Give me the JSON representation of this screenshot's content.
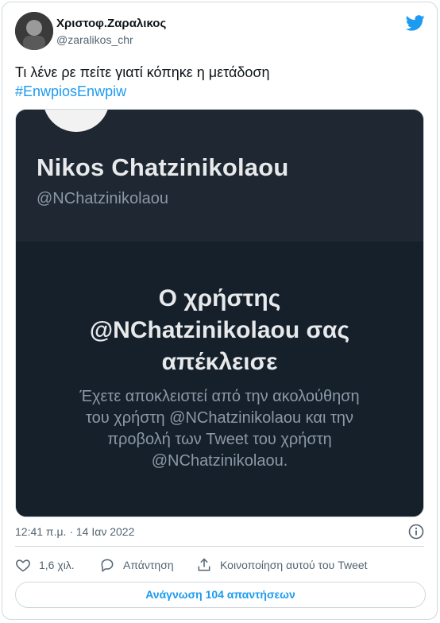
{
  "author": {
    "display_name": "Χριστοφ.Ζαραλικος",
    "handle": "@zaralikos_chr"
  },
  "tweet": {
    "text": "Τι λένε ρε πείτε γιατί κόπηκε η μετάδοση",
    "hashtag": "#EnwpiosEnwpiw"
  },
  "media": {
    "profile_name": "Nikos Chatzinikolaou",
    "profile_handle": "@NChatzinikolaou",
    "blocked_lines": [
      "Ο χρήστης",
      "@NChatzinikolaou σας",
      "απέκλεισε"
    ],
    "description_lines": [
      "Έχετε αποκλειστεί από την ακολούθηση",
      "του χρήστη @NChatzinikolaou και την",
      "προβολή των Tweet του χρήστη",
      "@NChatzinikolaou."
    ]
  },
  "meta": {
    "timestamp": "12:41 π.μ. · 14 Ιαν 2022"
  },
  "actions": {
    "like_count": "1,6 χιλ.",
    "reply_label": "Απάντηση",
    "share_label": "Κοινοποίηση αυτού του Tweet"
  },
  "read_replies_label": "Ανάγνωση 104 απαντήσεων",
  "icons": [
    "twitter-bird-icon",
    "info-icon",
    "heart-icon",
    "reply-icon",
    "share-icon"
  ],
  "colors": {
    "accent": "#1d9bf0",
    "muted": "#536471",
    "media_bg": "#15202b"
  }
}
